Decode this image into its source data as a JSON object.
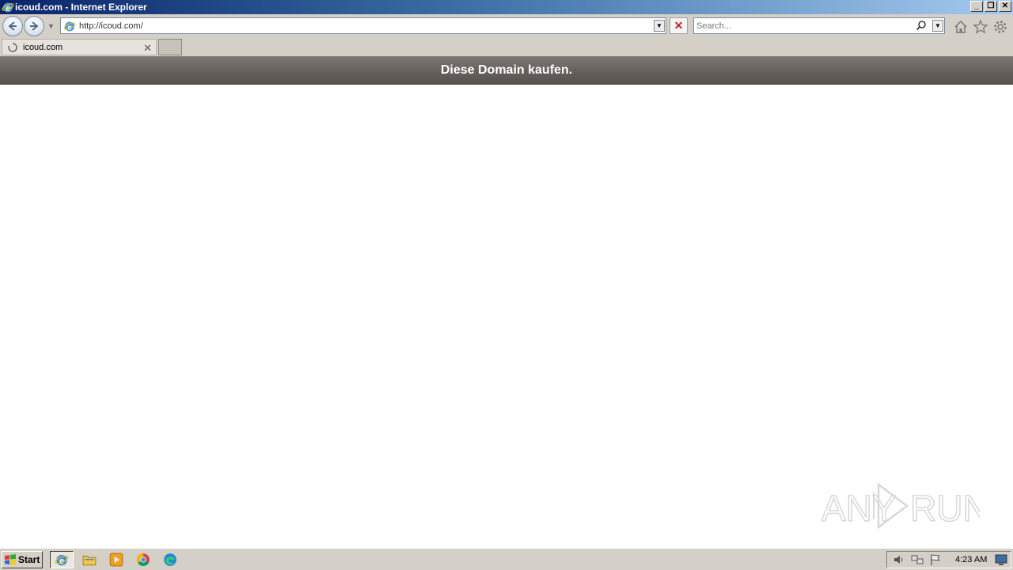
{
  "window": {
    "title": "icoud.com - Internet Explorer",
    "controls": [
      "minimize",
      "restore",
      "close"
    ]
  },
  "navbar": {
    "back_icon": "back-arrow-icon",
    "forward_icon": "forward-arrow-icon",
    "address_url": "http://icoud.com/",
    "search_placeholder": "Search...",
    "toolbar_icons": [
      "home-icon",
      "favorites-star-icon",
      "settings-gear-icon"
    ]
  },
  "tabs": [
    {
      "title": "icoud.com",
      "loading": true
    }
  ],
  "page": {
    "banner_text": "Diese Domain kaufen.",
    "banner_color": "#66605c"
  },
  "watermark": {
    "text_left": "ANY",
    "text_right": "RUN"
  },
  "taskbar": {
    "start_label": "Start",
    "apps": [
      "internet-explorer",
      "file-explorer",
      "media-player",
      "chrome",
      "edge"
    ],
    "clock": "4:23 AM"
  },
  "colors": {
    "titlebar_start": "#0a246a",
    "titlebar_end": "#a6caf0",
    "chrome_bg": "#d4d0c8"
  }
}
